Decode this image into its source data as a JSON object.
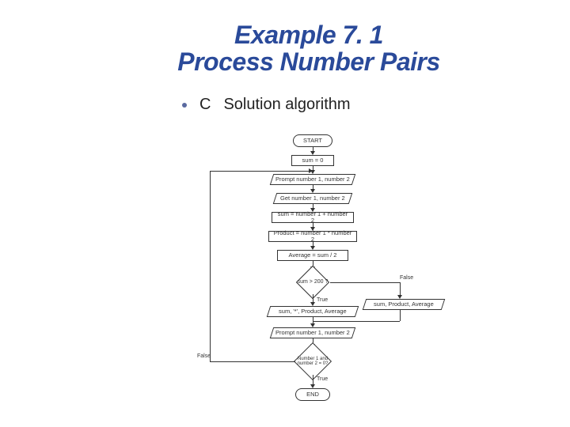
{
  "title": {
    "line1": "Example 7. 1",
    "line2": "Process Number Pairs"
  },
  "bullet": {
    "marker": "C",
    "text": "Solution algorithm"
  },
  "flow": {
    "start": "START",
    "init": "sum = 0",
    "prompt": "Prompt number 1, number 2",
    "get": "Get number 1, number 2",
    "calc_sum": "sum = number 1 + number 2",
    "calc_prod": "Product = number 1 * number 2",
    "calc_avg": "Average = sum / 2",
    "decision1": "sum > 200 ?",
    "true1": "True",
    "false1": "False",
    "print_star": "sum, '*', Product, Average",
    "print_plain": "sum, Product, Average",
    "prompt2": "Prompt number 1, number 2",
    "decision2": "Number 1 and number 2 = 0?",
    "true2": "True",
    "false2": "False",
    "end": "END"
  }
}
